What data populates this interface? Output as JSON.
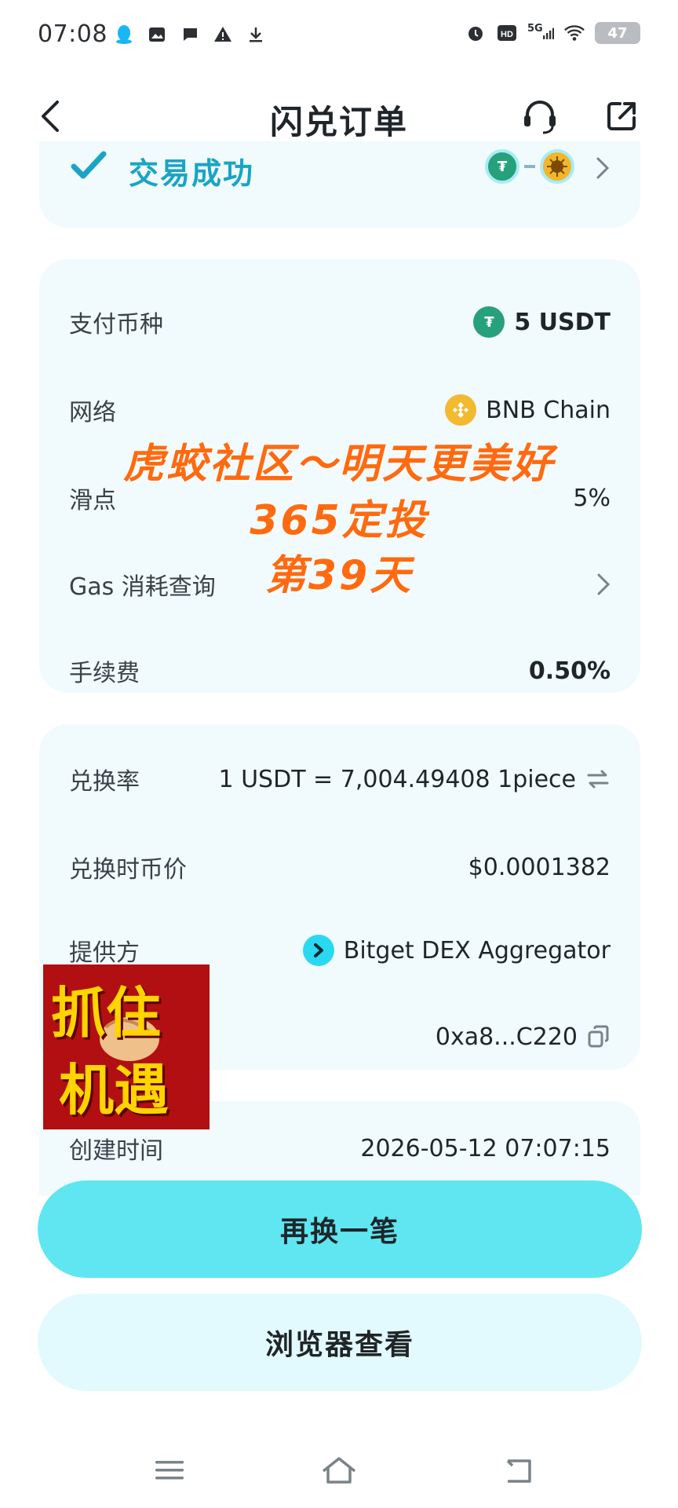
{
  "status_bar": {
    "time": "07:08",
    "network_label": "5G",
    "hd_label": "HD",
    "battery": "47"
  },
  "header": {
    "title": "闪兑订单"
  },
  "status_card": {
    "text": "交易成功",
    "pair_from_icon": "usdt-coin-icon",
    "pair_to_icon": "1piece-coin-icon"
  },
  "card1": {
    "rows": [
      {
        "label": "支付币种",
        "value": "5 USDT"
      },
      {
        "label": "网络",
        "value": "BNB Chain"
      },
      {
        "label": "滑点",
        "value": "5%"
      },
      {
        "label": "Gas 消耗查询",
        "value": ""
      },
      {
        "label": "手续费",
        "value": "0.50%"
      }
    ]
  },
  "card2": {
    "rows": [
      {
        "label": "兑换率",
        "value": "1 USDT = 7,004.49408 1piece"
      },
      {
        "label": "兑换时币价",
        "value": "$0.0001382"
      },
      {
        "label": "提供方",
        "value": "Bitget DEX Aggregator"
      },
      {
        "label": "",
        "value": "0xa8...C220"
      }
    ]
  },
  "card3": {
    "label": "创建时间",
    "value": "2026-05-12 07:07:15"
  },
  "watermark": {
    "line1": "虎蛟社区～明天更美好",
    "line2": "365定投",
    "line3": "第39天"
  },
  "sticker": {
    "line1": "抓住",
    "line2": "机遇"
  },
  "buttons": {
    "primary": "再换一笔",
    "secondary": "浏览器查看"
  },
  "colors": {
    "accent": "#5fe6f1",
    "success": "#1aa4c4",
    "card_bg": "#f1fafd",
    "watermark": "#ff6a10"
  }
}
